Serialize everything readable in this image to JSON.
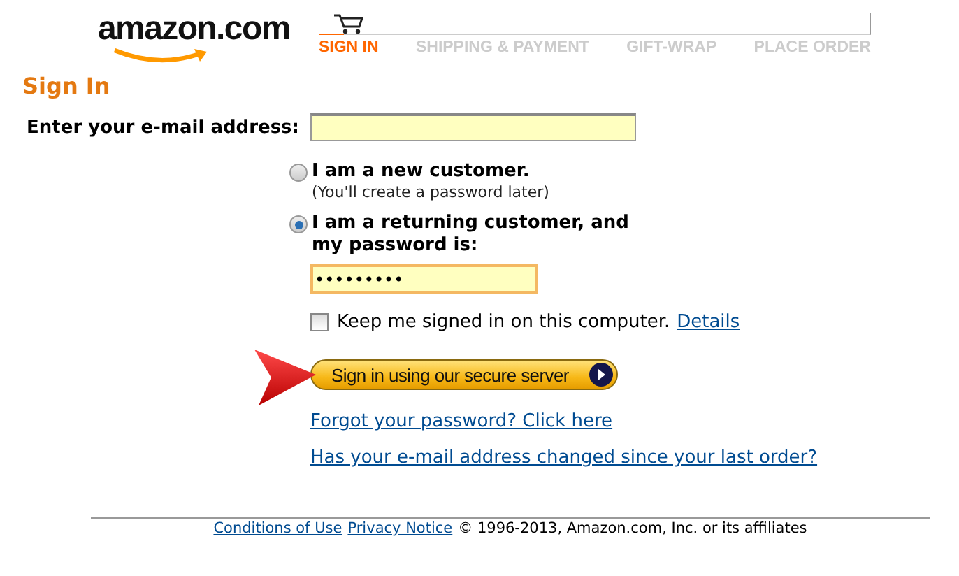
{
  "logo": {
    "text": "amazon.com"
  },
  "steps": [
    {
      "label": "SIGN IN",
      "selected": true
    },
    {
      "label": "SHIPPING & PAYMENT",
      "selected": false
    },
    {
      "label": "GIFT-WRAP",
      "selected": false
    },
    {
      "label": "PLACE ORDER",
      "selected": false
    }
  ],
  "heading": "Sign In",
  "email_label": "Enter your e-mail address:",
  "customer_options": [
    {
      "label": "I am a new customer.",
      "note": "(You'll create a password later)",
      "selected": false
    },
    {
      "label": "I am a returning customer, and my password is:",
      "selected": true
    }
  ],
  "password": {
    "value": "•••••••••"
  },
  "keep_signed_in": {
    "label": "Keep me signed in on this computer.",
    "checked": false,
    "link": "Details"
  },
  "sign_in_button": "Sign in using our secure server",
  "links": [
    "Forgot your password? Click here",
    "Has your e-mail address changed since your last order?"
  ],
  "footer": {
    "links": [
      "Conditions of Use",
      "Privacy Notice"
    ],
    "text": "© 1996-2013, Amazon.com, Inc. or its affiliates"
  }
}
